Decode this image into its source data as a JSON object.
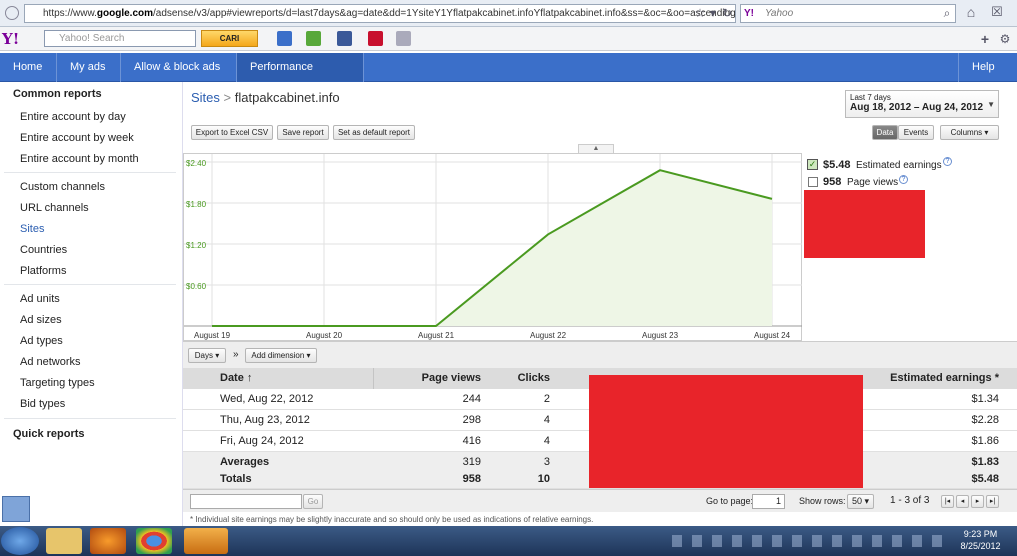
{
  "browser": {
    "url_prefix": "https://www.",
    "url_domain": "google.com",
    "url_rest": "/adsense/v3/app#viewreports/d=last7days&ag=date&dd=1YsiteY1Yflatpakcabinet.infoYflatpakcabinet.info&ss=&oc=&oo=ascending&",
    "search_placeholder": "Yahoo",
    "search_brand": "Y!"
  },
  "toolbar": {
    "yahoo_logo": "Y!",
    "search_placeholder": "Yahoo! Search",
    "cari_label": "CARI"
  },
  "nav": {
    "tabs": [
      {
        "label": "Home"
      },
      {
        "label": "My ads"
      },
      {
        "label": "Allow & block ads"
      },
      {
        "label": "Performance reports"
      },
      {
        "label": "Help"
      }
    ]
  },
  "sidebar": {
    "common_heading": "Common reports",
    "items": [
      "Entire account by day",
      "Entire account by week",
      "Entire account by month",
      "Custom channels",
      "URL channels",
      "Sites",
      "Countries",
      "Platforms",
      "Ad units",
      "Ad sizes",
      "Ad types",
      "Ad networks",
      "Targeting types",
      "Bid types"
    ],
    "quick_heading": "Quick reports"
  },
  "breadcrumb": {
    "root": "Sites",
    "sep": ">",
    "current": "flatpakcabinet.info"
  },
  "date_range": {
    "label": "Last 7 days",
    "value": "Aug 18, 2012 – Aug 24, 2012"
  },
  "buttons": {
    "export": "Export to Excel CSV",
    "save": "Save report",
    "set_default": "Set as default report",
    "data": "Data",
    "events": "Events",
    "columns": "Columns"
  },
  "legend": {
    "earnings_value": "$5.48",
    "earnings_label": "Estimated earnings",
    "pageviews_value": "958",
    "pageviews_label": "Page views",
    "help_icon": "?"
  },
  "chart_data": {
    "type": "area",
    "x": [
      "August 19",
      "August 20",
      "August 21",
      "August 22",
      "August 23",
      "August 24"
    ],
    "y_ticks": [
      "$2.40",
      "$1.80",
      "$1.20",
      "$0.60"
    ],
    "ylim": [
      0,
      2.4
    ],
    "series": [
      {
        "name": "Estimated earnings",
        "values": [
          0,
          0,
          0,
          1.34,
          2.28,
          1.86
        ]
      }
    ],
    "line_color": "#4a9a20",
    "fill_color": "#eef6e6",
    "grid": true
  },
  "table_controls": {
    "days": "Days",
    "arrow": "»",
    "add_dimension": "Add dimension"
  },
  "table": {
    "headers": {
      "date": "Date ↑",
      "pageviews": "Page views",
      "clicks": "Clicks",
      "earnings": "Estimated earnings *"
    },
    "rows": [
      {
        "date": "Wed, Aug 22, 2012",
        "pageviews": "244",
        "clicks": "2",
        "earnings": "$1.34"
      },
      {
        "date": "Thu, Aug 23, 2012",
        "pageviews": "298",
        "clicks": "4",
        "earnings": "$2.28"
      },
      {
        "date": "Fri, Aug 24, 2012",
        "pageviews": "416",
        "clicks": "4",
        "earnings": "$1.86"
      }
    ],
    "averages": {
      "label": "Averages",
      "pageviews": "319",
      "clicks": "3",
      "earnings": "$1.83"
    },
    "totals": {
      "label": "Totals",
      "pageviews": "958",
      "clicks": "10",
      "earnings": "$5.48"
    }
  },
  "footer": {
    "go": "Go",
    "go_to_page": "Go to page:",
    "page_value": "1",
    "show_rows": "Show rows:",
    "rows_value": "50",
    "range": "1 - 3 of 3",
    "note": "* Individual site earnings may be slightly inaccurate and so should only be used as indications of relative earnings."
  },
  "clock": {
    "time": "9:23 PM",
    "date": "8/25/2012"
  }
}
